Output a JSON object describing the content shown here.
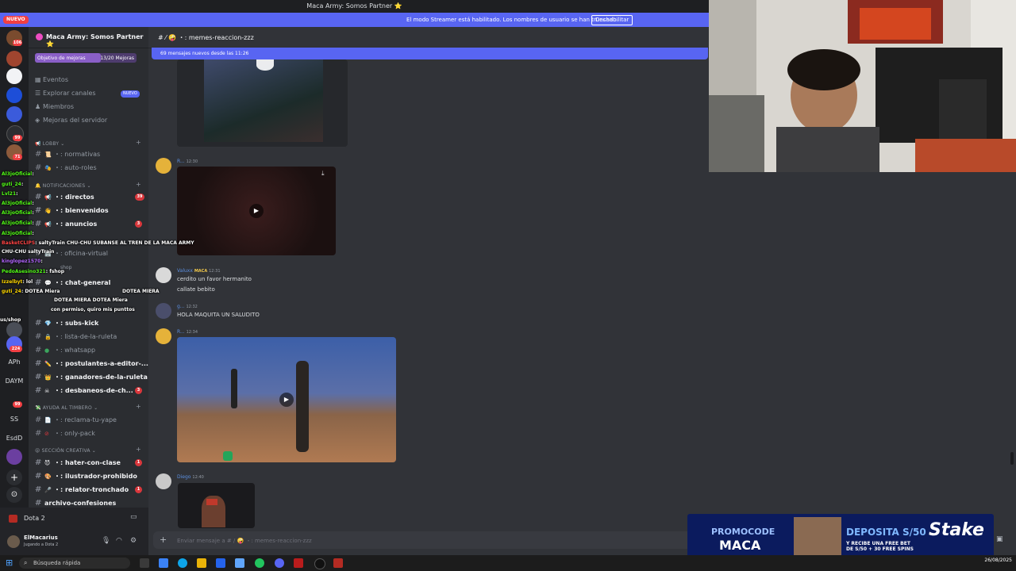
{
  "window": {
    "title": "Maca Army: Somos Partner ⭐"
  },
  "streamer_banner": {
    "message": "El modo Streamer está habilitado. Los nombres de usuario se han truncado.",
    "button": "Deshabilitar"
  },
  "rail_badge": "NUEVO",
  "rail": {
    "badges": [
      "106",
      "99",
      "71",
      "224",
      "99"
    ],
    "labels": [
      "APh",
      "DAYM",
      "SS",
      "EsdD"
    ]
  },
  "server": {
    "name": "Maca Army: Somos Partner ⭐",
    "boost_goal": "Objetivo de mejoras",
    "boost_count": "13/20 Mejoras",
    "boost_progress": 0.65
  },
  "nav": [
    {
      "label": "Eventos",
      "icon": "calendar-icon"
    },
    {
      "label": "Explorar canales",
      "icon": "browse-icon",
      "tag": "NUEVO"
    },
    {
      "label": "Miembros",
      "icon": "members-icon"
    },
    {
      "label": "Mejoras del servidor",
      "icon": "boost-icon"
    }
  ],
  "categories": {
    "lobby": "LOBBY",
    "notificaciones": "NOTIFICACIONES",
    "ayuda": "AYUDA AL TIMBERO",
    "creativa": "SECCIÓN CREATIVA"
  },
  "channels": {
    "normativas": "normativas",
    "auto_roles": "auto-roles",
    "directos": "directos",
    "directos_badge": "39",
    "bienvenidos": "bienvenidos",
    "anuncios": "anuncios",
    "anuncios_badge": "3",
    "oficina_virtual": "oficina-virtual",
    "shop": "shop",
    "chat_general": "chat-general",
    "subs_kick": "subs-kick",
    "lista_ruleta": "lista-de-la-ruleta",
    "whatsapp": "whatsapp",
    "postulantes": "postulantes-a-editor-...",
    "ganadores": "ganadores-de-la-ruleta",
    "desbaneos": "desbaneos-de-ch...",
    "desbaneos_badge": "3",
    "reclama": "reclama-tu-yape",
    "only_pack": "only-pack",
    "hater": "hater-con-clase",
    "hater_badge": "1",
    "ilustrador": "ilustrador-prohibido",
    "relator": "relator-tronchado",
    "relator_badge": "1",
    "archivo": "archivo-confesiones"
  },
  "voice": {
    "label": "Dota 2"
  },
  "user": {
    "name": "ElMacarius",
    "status": "Jugando a Dota 2"
  },
  "chat": {
    "channel": "memes-reaccion-zzz",
    "new_messages": "69 mensajes nuevos desde las 11:26",
    "messages": [
      {
        "user": "R...",
        "time": "12:30"
      },
      {
        "user": "Valuxx",
        "tag": "MACA",
        "time": "12:31",
        "lines": [
          "cerdito un favor hermanito",
          "callate bebito"
        ]
      },
      {
        "user": "g...",
        "time": "12:32",
        "lines": [
          "HOLA MAQUITA UN SALUDITO"
        ]
      },
      {
        "user": "R...",
        "time": "12:34"
      },
      {
        "user": "Diego",
        "time": "12:40"
      }
    ],
    "composer_placeholder": "Enviar mensaje a # / 🤪 ・: memes-reaccion-zzz"
  },
  "overlay_chat": [
    {
      "user": "Al3joOficial",
      "text": ""
    },
    {
      "user": "guti_24",
      "text": ""
    },
    {
      "user": "Lvl21",
      "text": ""
    },
    {
      "user": "Al3joOficial",
      "text": ""
    },
    {
      "user": "Al3joOficial",
      "text": ""
    },
    {
      "user": "Al3joOficial",
      "text": ""
    },
    {
      "user": "Al3joOficial",
      "text": ""
    },
    {
      "user": "BasketCLIPS",
      "text": "saltyTrain CHU-CHU SUBANSE AL TREN DE LA MACA ARMY"
    },
    {
      "user": "",
      "text": "CHU-CHU saltyTrain"
    },
    {
      "user": "kinglopez1570",
      "text": ""
    },
    {
      "user": "PedoAsesino321",
      "text": "fshop"
    },
    {
      "user": "Izzelbyt",
      "text": "lol"
    },
    {
      "user": "guti_24",
      "text": "DOTEA Miera"
    },
    {
      "user": "",
      "text": "DOTEA MIERA DOTEA Miera"
    },
    {
      "user": "",
      "text": "DOTEA MIERA"
    },
    {
      "user": "",
      "text": "con permiso, quiro mis punttos"
    },
    {
      "user": "us/shop",
      "text": ""
    }
  ],
  "ad": {
    "promo_label": "PROMOCODE",
    "promo_code": "MACA",
    "deposit": "DEPOSITA S/50",
    "offer": "Y RECIBE UNA FREE BET DE S/50 + 30 FREE SPINS",
    "brand": "Stake"
  },
  "taskbar": {
    "search": "Búsqueda rápida",
    "date": "26/08/2025"
  }
}
